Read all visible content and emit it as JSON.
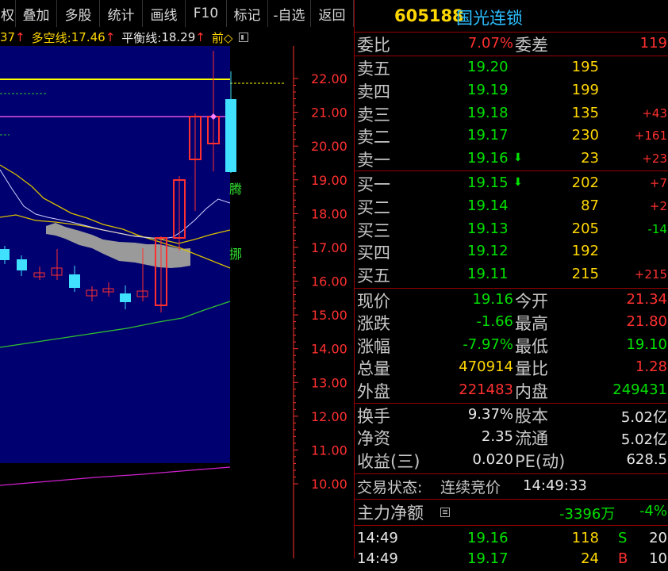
{
  "toolbar": {
    "buttons": [
      "权",
      "叠加",
      "多股",
      "统计",
      "画线",
      "F10",
      "标记",
      "-自选",
      "返回"
    ]
  },
  "indicator": {
    "partial_value": "37",
    "duokong_label": "多空线:",
    "duokong_value": "17.46",
    "pingheng_label": "平衡线:",
    "pingheng_value": "18.29",
    "more_label": "前◇"
  },
  "chart": {
    "price_axis": [
      "22.00",
      "21.00",
      "20.00",
      "19.00",
      "18.00",
      "17.00",
      "16.00",
      "15.00",
      "14.00",
      "13.00",
      "12.00",
      "11.00",
      "10.00"
    ],
    "price_range": [
      9.7,
      22.5
    ],
    "annotations": [
      "腾",
      "挪"
    ],
    "colors": {
      "up": "#ff3030",
      "down": "#40e0ff",
      "background": "#000070",
      "axis": "#ff3030"
    }
  },
  "quote": {
    "code": "605188",
    "name": "国光连锁",
    "weibi_label": "委比",
    "weibi_value": "7.07%",
    "weicha_label": "委差",
    "weicha_value": "119",
    "sell": [
      {
        "label": "卖五",
        "price": "19.20",
        "volume": "195",
        "change": ""
      },
      {
        "label": "卖四",
        "price": "19.19",
        "volume": "199",
        "change": ""
      },
      {
        "label": "卖三",
        "price": "19.18",
        "volume": "135",
        "change": "+43"
      },
      {
        "label": "卖二",
        "price": "19.17",
        "volume": "230",
        "change": "+161"
      },
      {
        "label": "卖一",
        "price": "19.16",
        "volume": "23",
        "change": "+23"
      }
    ],
    "buy": [
      {
        "label": "买一",
        "price": "19.15",
        "volume": "202",
        "change": "+7"
      },
      {
        "label": "买二",
        "price": "19.14",
        "volume": "87",
        "change": "+2"
      },
      {
        "label": "买三",
        "price": "19.13",
        "volume": "205",
        "change": "-14"
      },
      {
        "label": "买四",
        "price": "19.12",
        "volume": "192",
        "change": ""
      },
      {
        "label": "买五",
        "price": "19.11",
        "volume": "215",
        "change": "+215"
      }
    ],
    "stats_left": [
      {
        "label": "现价",
        "value": "19.16"
      },
      {
        "label": "涨跌",
        "value": "-1.66"
      },
      {
        "label": "涨幅",
        "value": "-7.97%"
      },
      {
        "label": "总量",
        "value": "470914"
      },
      {
        "label": "外盘",
        "value": "221483"
      }
    ],
    "stats_right": [
      {
        "label": "今开",
        "value": "21.34"
      },
      {
        "label": "最高",
        "value": "21.80"
      },
      {
        "label": "最低",
        "value": "19.10"
      },
      {
        "label": "量比",
        "value": "1.28"
      },
      {
        "label": "内盘",
        "value": "249431"
      }
    ],
    "info_left": [
      {
        "label": "换手",
        "value": "9.37%"
      },
      {
        "label": "净资",
        "value": "2.35"
      },
      {
        "label": "收益(三)",
        "value": "0.020"
      }
    ],
    "info_right": [
      {
        "label": "股本",
        "value": "5.02亿"
      },
      {
        "label": "流通",
        "value": "5.02亿"
      },
      {
        "label": "PE(动)",
        "value": "628.5"
      }
    ],
    "trade_status_label": "交易状态:",
    "trade_status_value": "连续竞价",
    "trade_time": "14:49:33",
    "main_net_label": "主力净额",
    "main_net_value": "-3396万",
    "main_net_pct": "-4%",
    "ticks": [
      {
        "time": "14:49",
        "price": "19.16",
        "volume": "118",
        "flag": "S",
        "count": "20"
      },
      {
        "time": "14:49",
        "price": "19.17",
        "volume": "24",
        "flag": "B",
        "count": "10"
      }
    ]
  }
}
